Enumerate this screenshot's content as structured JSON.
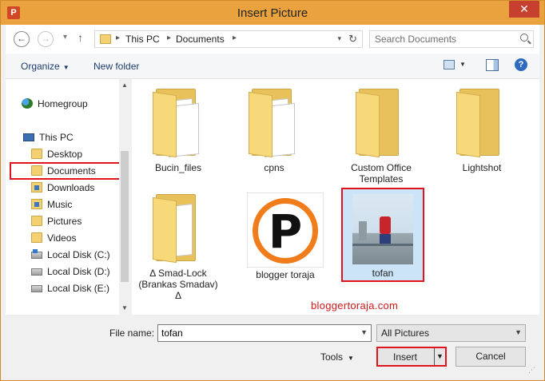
{
  "window": {
    "title": "Insert Picture",
    "close_label": "✕",
    "app_icon_label": "P"
  },
  "nav": {
    "address": [
      "This PC",
      "Documents"
    ],
    "search_placeholder": "Search Documents"
  },
  "toolbar": {
    "organize": "Organize",
    "new_folder": "New folder"
  },
  "sidebar": {
    "items": [
      {
        "label": "Homegroup",
        "icon": "homegroup-icon"
      },
      {
        "label": "This PC",
        "icon": "computer-icon"
      },
      {
        "label": "Desktop",
        "icon": "folder-icon"
      },
      {
        "label": "Documents",
        "icon": "folder-icon",
        "selected": true
      },
      {
        "label": "Downloads",
        "icon": "folder-icon"
      },
      {
        "label": "Music",
        "icon": "folder-icon"
      },
      {
        "label": "Pictures",
        "icon": "folder-icon"
      },
      {
        "label": "Videos",
        "icon": "folder-icon"
      },
      {
        "label": "Local Disk (C:)",
        "icon": "disk-icon"
      },
      {
        "label": "Local Disk (D:)",
        "icon": "disk-icon"
      },
      {
        "label": "Local Disk (E:)",
        "icon": "disk-icon"
      }
    ]
  },
  "files": [
    {
      "name": "Bucin_files",
      "type": "folder"
    },
    {
      "name": "cpns",
      "type": "folder"
    },
    {
      "name": "Custom Office Templates",
      "type": "folder"
    },
    {
      "name": "Lightshot",
      "type": "folder"
    },
    {
      "name": "Δ Smad-Lock (Brankas Smadav) Δ",
      "type": "folder"
    },
    {
      "name": "blogger toraja",
      "type": "image",
      "logo_letter": "P"
    },
    {
      "name": "tofan",
      "type": "image",
      "selected": true
    }
  ],
  "watermark": "bloggertoraja.com",
  "footer": {
    "file_name_label": "File name:",
    "file_name_value": "tofan",
    "filter_value": "All Pictures",
    "tools_label": "Tools",
    "insert_label": "Insert",
    "cancel_label": "Cancel"
  },
  "colors": {
    "title_bar": "#eaa23e",
    "highlight_red": "#e0141e",
    "selected_bg": "#cce4f7"
  }
}
